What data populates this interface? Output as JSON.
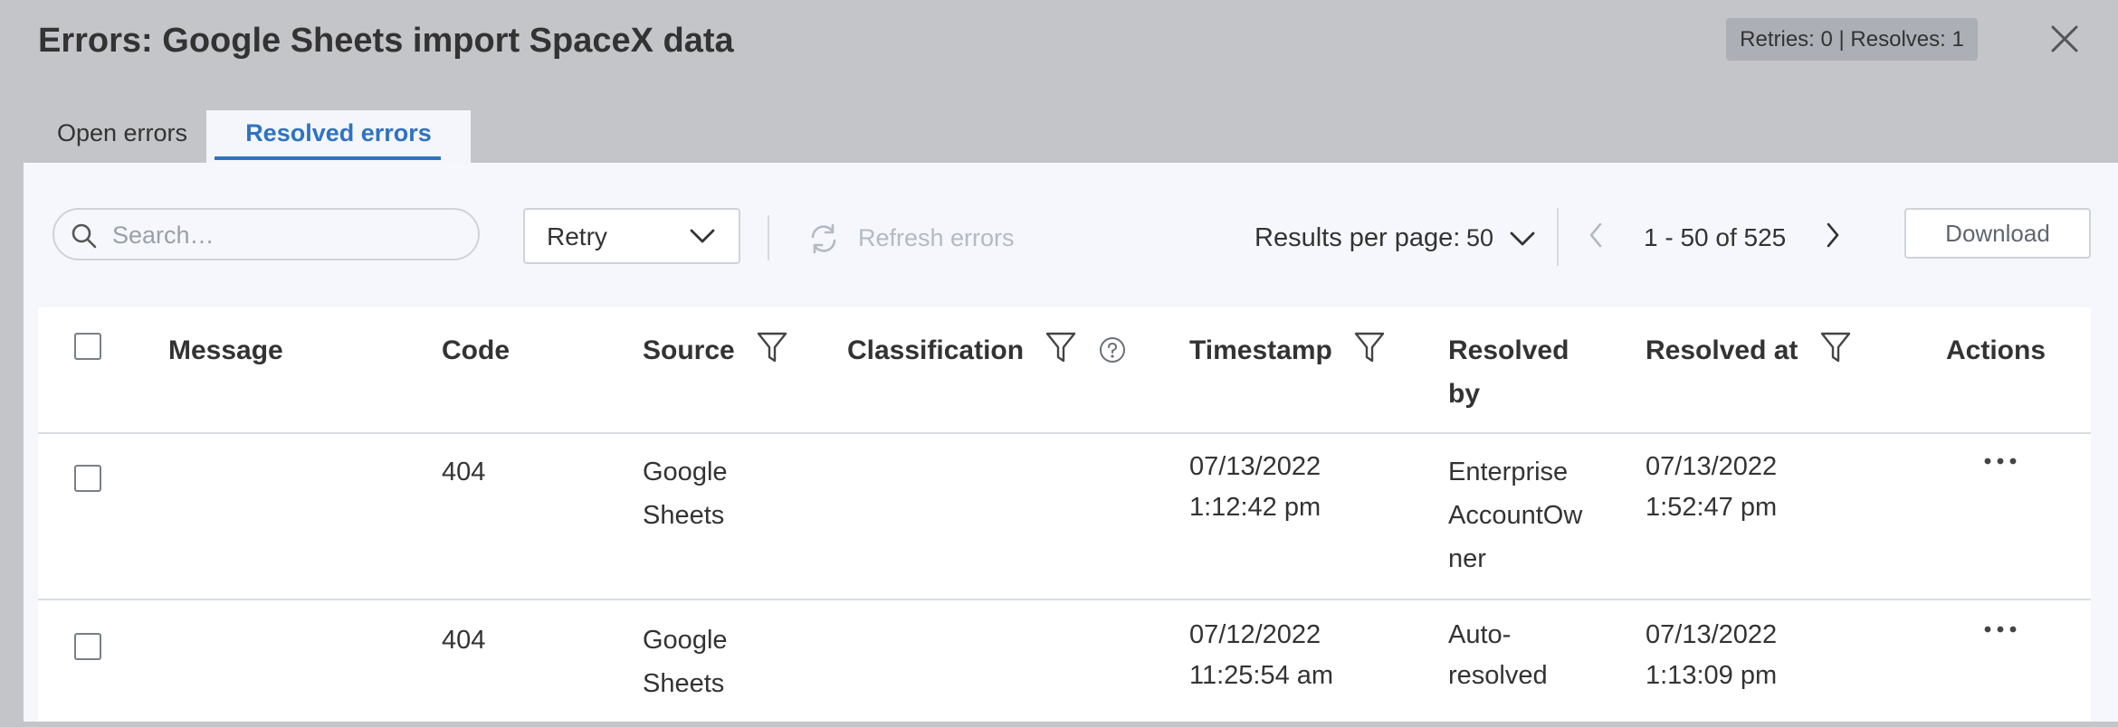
{
  "header": {
    "title": "Errors: Google Sheets import SpaceX data",
    "badge": "Retries: 0 | Resolves: 1"
  },
  "tabs": [
    {
      "label": "Open errors",
      "active": false
    },
    {
      "label": "Resolved errors",
      "active": true
    }
  ],
  "toolbar": {
    "search_placeholder": "Search…",
    "retry_label": "Retry",
    "refresh_label": "Refresh errors",
    "results_per_page_label": "Results per page:",
    "results_per_page_value": "50",
    "pagination": "1 - 50 of 525",
    "download_label": "Download"
  },
  "table": {
    "columns": [
      "Message",
      "Code",
      "Source",
      "Classification",
      "Timestamp",
      "Resolved by",
      "Resolved at",
      "Actions"
    ],
    "rows": [
      {
        "message": "",
        "code": "404",
        "source": "Google Sheets",
        "classification": "",
        "timestamp_date": "07/13/2022",
        "timestamp_time": "1:12:42 pm",
        "resolved_by": "Enterprise AccountOwner",
        "resolved_at_date": "07/13/2022",
        "resolved_at_time": "1:52:47 pm"
      },
      {
        "message": "",
        "code": "404",
        "source": "Google Sheets",
        "classification": "",
        "timestamp_date": "07/12/2022",
        "timestamp_time": "11:25:54 am",
        "resolved_by": "Auto-resolved",
        "resolved_at_date": "07/13/2022",
        "resolved_at_time": "1:13:09 pm"
      }
    ]
  },
  "colors": {
    "accent": "#2f73c0",
    "overlay": "#c4c5c9",
    "panel": "#f5f7fc"
  },
  "icons": [
    "close-icon",
    "search-icon",
    "chevron-down-icon",
    "refresh-icon",
    "chevron-left-icon",
    "chevron-right-icon",
    "filter-icon",
    "help-icon",
    "more-icon"
  ]
}
